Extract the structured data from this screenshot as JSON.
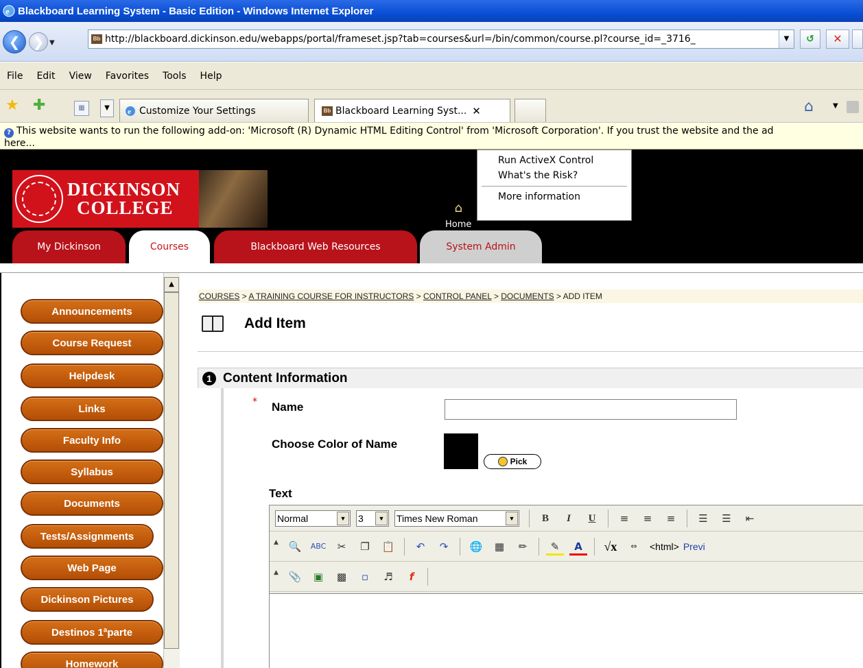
{
  "window": {
    "title": "Blackboard Learning System - Basic Edition - Windows Internet Explorer"
  },
  "address_bar": {
    "url": "http://blackboard.dickinson.edu/webapps/portal/frameset.jsp?tab=courses&url=/bin/common/course.pl?course_id=_3716_",
    "site_icon": "Bb"
  },
  "menu": [
    "File",
    "Edit",
    "View",
    "Favorites",
    "Tools",
    "Help"
  ],
  "browser_tabs": [
    {
      "label": "Customize Your Settings"
    },
    {
      "label": "Blackboard Learning Syst...",
      "close": "✕"
    }
  ],
  "infobar": {
    "line1": "This website wants to run the following add-on: 'Microsoft (R) Dynamic HTML Editing Control' from 'Microsoft Corporation'. If you trust the website and the ad",
    "line2": "here..."
  },
  "popup_menu": {
    "items": [
      "Run ActiveX Control",
      "What's the Risk?",
      "More information"
    ]
  },
  "header": {
    "logo_line1": "DICKINSON",
    "logo_line2": "COLLEGE",
    "home_label": "Home"
  },
  "portal_tabs": [
    {
      "label": "My Dickinson",
      "style": "red"
    },
    {
      "label": "Courses",
      "style": "white"
    },
    {
      "label": "Blackboard Web Resources",
      "style": "red"
    },
    {
      "label": "System Admin",
      "style": "gray"
    }
  ],
  "course_menu": [
    "Announcements",
    "Course Request",
    "Helpdesk",
    "Links",
    "Faculty Info",
    "Syllabus",
    "Documents",
    "Tests/Assignments",
    "Web Page",
    "Dickinson Pictures",
    "Destinos 1ªparte",
    "Homework"
  ],
  "breadcrumb": {
    "links": [
      "COURSES",
      "A TRAINING COURSE FOR INSTRUCTORS",
      "CONTROL PANEL",
      "DOCUMENTS"
    ],
    "separator": " > ",
    "current": "ADD ITEM"
  },
  "page": {
    "title": "Add Item",
    "section_number": "1",
    "section_title": "Content Information",
    "required_marker": "*",
    "name_label": "Name",
    "name_value": "",
    "color_label": "Choose Color of Name",
    "color_value": "#000000",
    "pick_label": "Pick",
    "text_label": "Text"
  },
  "editor": {
    "format": "Normal",
    "size": "3",
    "font": "Times New Roman",
    "bold": "B",
    "italic": "I",
    "underline": "U",
    "html_label": "<html>",
    "preview_label": "Previ"
  },
  "colors": {
    "ie_blue": "#0a4fd6",
    "dickinson_red": "#d2121b",
    "nav_orange": "#c55f0e",
    "infobar_yellow": "#ffffe1"
  }
}
